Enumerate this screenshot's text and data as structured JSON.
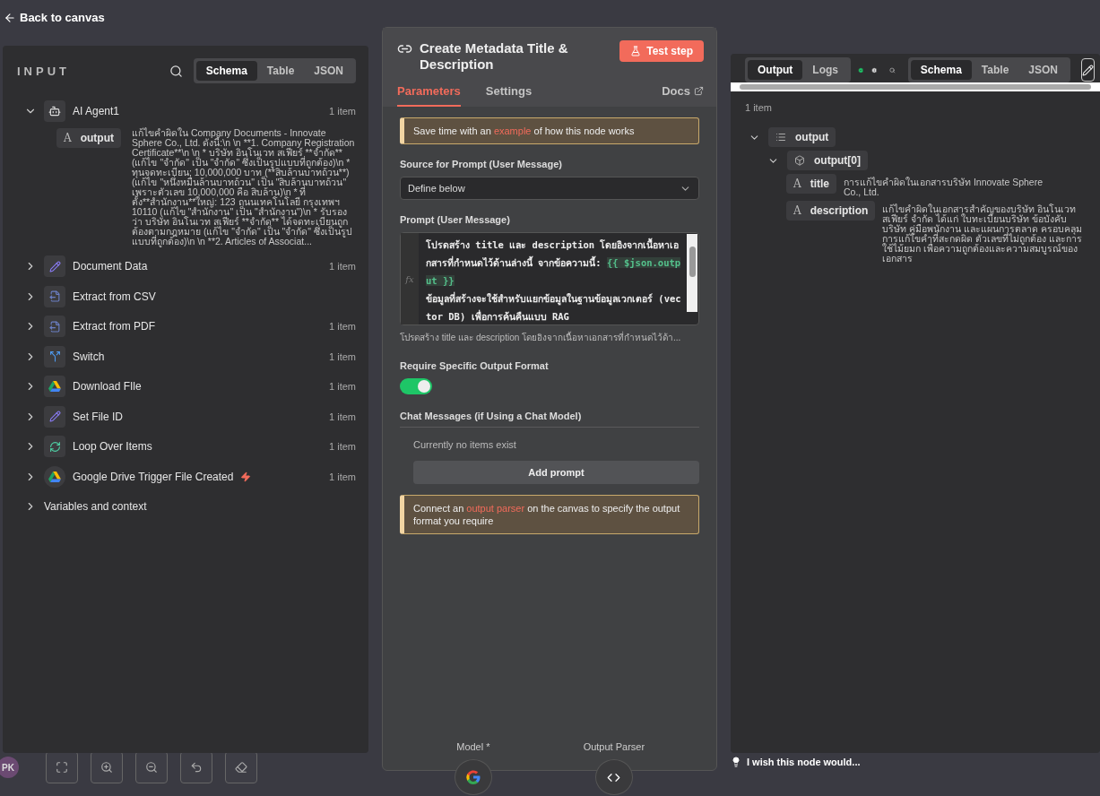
{
  "top_bar": {
    "back_label": "Back to canvas"
  },
  "input_panel": {
    "title": "INPUT",
    "view_tabs": [
      {
        "label": "Schema",
        "selected": true
      },
      {
        "label": "Table",
        "selected": false
      },
      {
        "label": "JSON",
        "selected": false
      }
    ],
    "nodes": [
      {
        "kind": "agent",
        "name": "AI Agent1",
        "count": "1 item",
        "expanded": true,
        "trigger": false,
        "fields": [
          {
            "type": "A",
            "name": "output",
            "value": "แก้ไขคำผิดใน Company Documents - Innovate Sphere Co., Ltd. ดังนี้:\\n \\n **1. Company Registration Certificate**\\n \\n * บริษัท อินโนเวท สเฟียร์ **จำกัด** (แก้ไข \"จำกัด\" เป็น \"จำกัด\" ซึ่งเป็นรูปแบบที่ถูกต้อง)\\n * ทุนจดทะเบียน: 10,000,000 บาท (**สิบล้านบาทถ้วน**) (แก้ไข \"หนึ่งหมื่นล้านบาทถ้วน\" เป็น \"สิบล้านบาทถ้วน\" เพราะตัวเลข 10,000,000 คือ สิบล้าน)\\n * ที่ตั้ง**สำนักงาน**ใหญ่: 123 ถนนเทคโนโลยี กรุงเทพฯ 10110 (แก้ไข \"สำนักงาน\" เป็น \"สำนักงาน\")\\n * รับรองว่า บริษัท อินโนเวท สเฟียร์ **จำกัด** ได้จดทะเบียนถูกต้องตามกฎหมาย (แก้ไข \"จำกัด\" เป็น \"จำกัด\" ซึ่งเป็นรูปแบบที่ถูกต้อง)\\n \\n **2. Articles of Associat..."
          }
        ]
      },
      {
        "kind": "edit",
        "name": "Document Data",
        "count": "1 item",
        "expanded": false,
        "trigger": false
      },
      {
        "kind": "extract",
        "name": "Extract from CSV",
        "expanded": false,
        "trigger": false
      },
      {
        "kind": "extract",
        "name": "Extract from PDF",
        "count": "1 item",
        "expanded": false,
        "trigger": false
      },
      {
        "kind": "switch",
        "name": "Switch",
        "count": "1 item",
        "expanded": false,
        "trigger": false
      },
      {
        "kind": "drive",
        "name": "Download FIle",
        "count": "1 item",
        "expanded": false,
        "trigger": false
      },
      {
        "kind": "edit",
        "name": "Set File ID",
        "count": "1 item",
        "expanded": false,
        "trigger": false
      },
      {
        "kind": "loop",
        "name": "Loop Over Items",
        "count": "1 item",
        "expanded": false,
        "trigger": false
      },
      {
        "kind": "drive",
        "name": "Google Drive Trigger File Created",
        "count": "1 item",
        "expanded": false,
        "trigger": true
      }
    ],
    "variables": {
      "label": "Variables and context",
      "expanded": false
    }
  },
  "node_panel": {
    "title": "Create Metadata Title & Description",
    "test_button": "Test step",
    "tabs": [
      {
        "label": "Parameters",
        "selected": true
      },
      {
        "label": "Settings",
        "selected": false
      }
    ],
    "docs_link": "Docs",
    "tip": {
      "before": "Save time with an ",
      "link": "example",
      "after": " of how this node works"
    },
    "source": {
      "label": "Source for Prompt (User Message)",
      "value": "Define below"
    },
    "prompt": {
      "label": "Prompt (User Message)",
      "fx_label": "fx",
      "text": "โปรดสร้าง title และ description โดยอิงจากเนื้อหาเอกสารที่กำหนดไว้ด้านล่างนี้ จากข้อความนี้: ",
      "expression": "{{ $json.output }}",
      "text2": "ข้อมูลที่สร้างจะใช้สำหรับแยกข้อมูลในฐานข้อมูลเวกเตอร์ (vector DB) เพื่อการค้นคืนแบบ RAG",
      "preview": "โปรดสร้าง title และ description โดยอิงจากเนื้อหาเอกสารที่กำหนดไว้ด้า..."
    },
    "output_format": {
      "label": "Require Specific Output Format",
      "on": true
    },
    "chat_messages": {
      "label": "Chat Messages (if Using a Chat Model)",
      "empty": "Currently no items exist",
      "button": "Add prompt"
    },
    "parser_tip": {
      "before": "Connect an ",
      "link": "output parser",
      "after": " on the canvas to specify the output format you require"
    },
    "connectors": [
      {
        "kind": "model",
        "label": "Model *"
      },
      {
        "kind": "parser",
        "label": "Output Parser"
      }
    ]
  },
  "output_panel": {
    "tabs": [
      {
        "label": "Output",
        "selected": true
      },
      {
        "label": "Logs",
        "selected": false
      }
    ],
    "view_tabs": [
      {
        "label": "Schema",
        "selected": true
      },
      {
        "label": "Table",
        "selected": false
      },
      {
        "label": "JSON",
        "selected": false
      }
    ],
    "count": "1 item",
    "tree": [
      {
        "kind": "list",
        "name": "output",
        "expanded": true,
        "children": [
          {
            "kind": "object",
            "name": "output[0]",
            "expanded": true,
            "children": [
              {
                "kind": "string",
                "type": "A",
                "name": "title",
                "value": "การแก้ไขคำผิดในเอกสารบริษัท Innovate Sphere Co., Ltd."
              },
              {
                "kind": "string",
                "type": "A",
                "name": "description",
                "value": "แก้ไขคำผิดในเอกสารสำคัญของบริษัท อินโนเวท สเฟียร์ จำกัด ได้แก่ ใบทะเบียนบริษัท ข้อบังคับบริษัท คู่มือพนักงาน และแผนการตลาด ครอบคลุมการแก้ไขคำที่สะกดผิด ตัวเลขที่ไม่ถูกต้อง และการใช้ไม้ยมก เพื่อความถูกต้องและความสมบูรณ์ของเอกสาร"
              }
            ]
          }
        ]
      }
    ]
  },
  "feedback": "I wish this node would...",
  "avatar": "PK"
}
